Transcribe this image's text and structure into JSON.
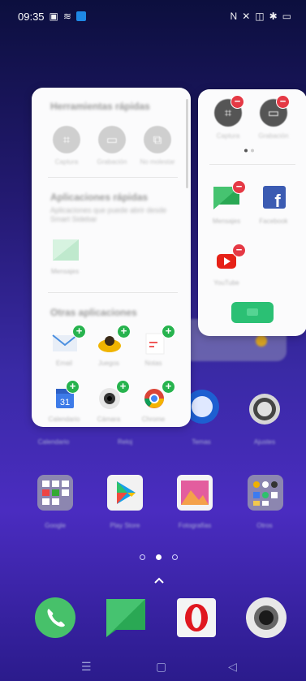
{
  "status_bar": {
    "time": "09:35"
  },
  "left_panel": {
    "quick_tools_title": "Herramientas rápidas",
    "quick_apps_title": "Aplicaciones rápidas",
    "quick_apps_hint": "Aplicaciones que puede abrir desde Smart Sidebar",
    "other_apps_title": "Otras aplicaciones",
    "tools": [
      {
        "icon": "crop-icon",
        "label": "Captura"
      },
      {
        "icon": "video-icon",
        "label": "Grabación"
      },
      {
        "icon": "screen-record-icon",
        "label": "No molestar"
      }
    ],
    "quick_app": {
      "icon": "messages-icon",
      "label": "Mensajes"
    },
    "other_apps": [
      {
        "icon": "mail-icon",
        "label": "Email"
      },
      {
        "icon": "game-icon",
        "label": "Juegos"
      },
      {
        "icon": "notes-icon",
        "label": "Notas"
      },
      {
        "icon": "calendar-icon",
        "label": "Calendario",
        "number": "31"
      },
      {
        "icon": "camera-icon",
        "label": "Cámara"
      },
      {
        "icon": "chrome-icon",
        "label": "Chrome"
      }
    ]
  },
  "right_panel": {
    "tools": [
      {
        "icon": "crop-icon",
        "label": "Captura"
      },
      {
        "icon": "video-icon",
        "label": "Grabación"
      }
    ],
    "apps": [
      {
        "icon": "messages-icon",
        "label": "Mensajes"
      },
      {
        "icon": "facebook-icon",
        "label": "Facebook",
        "glyph": "f"
      },
      {
        "icon": "youtube-icon",
        "label": "YouTube"
      }
    ]
  },
  "home_screen": {
    "row_labels": [
      "Calendario",
      "Reloj",
      "Temas",
      "Ajustes"
    ],
    "folder_labels": [
      "Google",
      "Play Store",
      "Fotografías",
      "Otros"
    ]
  },
  "dock": [
    "phone-icon",
    "messages-icon",
    "opera-icon",
    "camera-icon"
  ],
  "colors": {
    "accent_green": "#2bc074",
    "remove_red": "#e53945",
    "add_green": "#27b34e"
  }
}
